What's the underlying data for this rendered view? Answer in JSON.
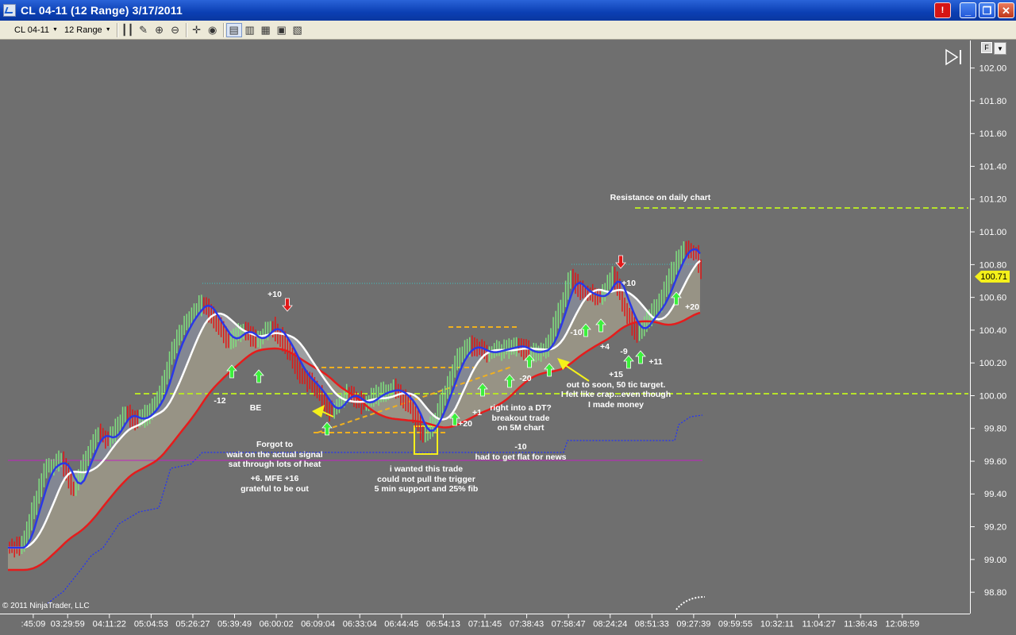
{
  "window": {
    "title": "CL 04-11 (12 Range)  3/17/2011",
    "alert_label": "!",
    "min_label": "_",
    "max_label": "❐",
    "close_label": "✕"
  },
  "toolbar": {
    "instrument": "CL 04-11",
    "interval": "12 Range"
  },
  "chart": {
    "copyright": "© 2011 NinjaTrader, LLC",
    "last_price": "100.71",
    "flag_label": "F",
    "y_ticks": [
      "102.00",
      "101.80",
      "101.60",
      "101.40",
      "101.20",
      "101.00",
      "100.80",
      "100.60",
      "100.40",
      "100.20",
      "100.00",
      "99.80",
      "99.60",
      "99.40",
      "99.20",
      "99.00",
      "98.80"
    ],
    "x_ticks": [
      ":45:09",
      "03:29:59",
      "04:11:22",
      "05:04:53",
      "05:26:27",
      "05:39:49",
      "06:00:02",
      "06:09:04",
      "06:33:04",
      "06:44:45",
      "06:54:13",
      "07:11:45",
      "07:38:43",
      "07:58:47",
      "08:24:24",
      "08:51:33",
      "09:27:39",
      "09:59:55",
      "10:32:11",
      "11:04:27",
      "11:36:43",
      "12:08:59"
    ],
    "annotations": {
      "resistance": "Resistance on daily chart",
      "plus10_a": "+10",
      "minus12": "-12",
      "be": "BE",
      "forgot1": "Forgot to",
      "forgot2": "wait on the actual signal",
      "forgot3": "sat through lots of heat",
      "mfe1": "+6. MFE +16",
      "mfe2": "grateful to be out",
      "wanted1": "i wanted this trade",
      "wanted2": "could not pull the trigger",
      "wanted3": "5 min support and 25% fib",
      "plus20_a": "+20",
      "plus1": "+1",
      "dt1": "right into a DT?",
      "dt2": "breakout trade",
      "dt3": "on 5M chart",
      "minus10_a": "-10",
      "news": "had to get flat for news",
      "minus20": "-20",
      "soon1": "out to soon, 50 tic target.",
      "soon2": "I felt like crap...even though",
      "soon3": "I made money",
      "minus10_b": "-10",
      "plus4": "+4",
      "minus9": "-9",
      "plus15": "+15",
      "plus11": "+11",
      "plus10_b": "+10",
      "plus20_b": "+20"
    }
  }
}
